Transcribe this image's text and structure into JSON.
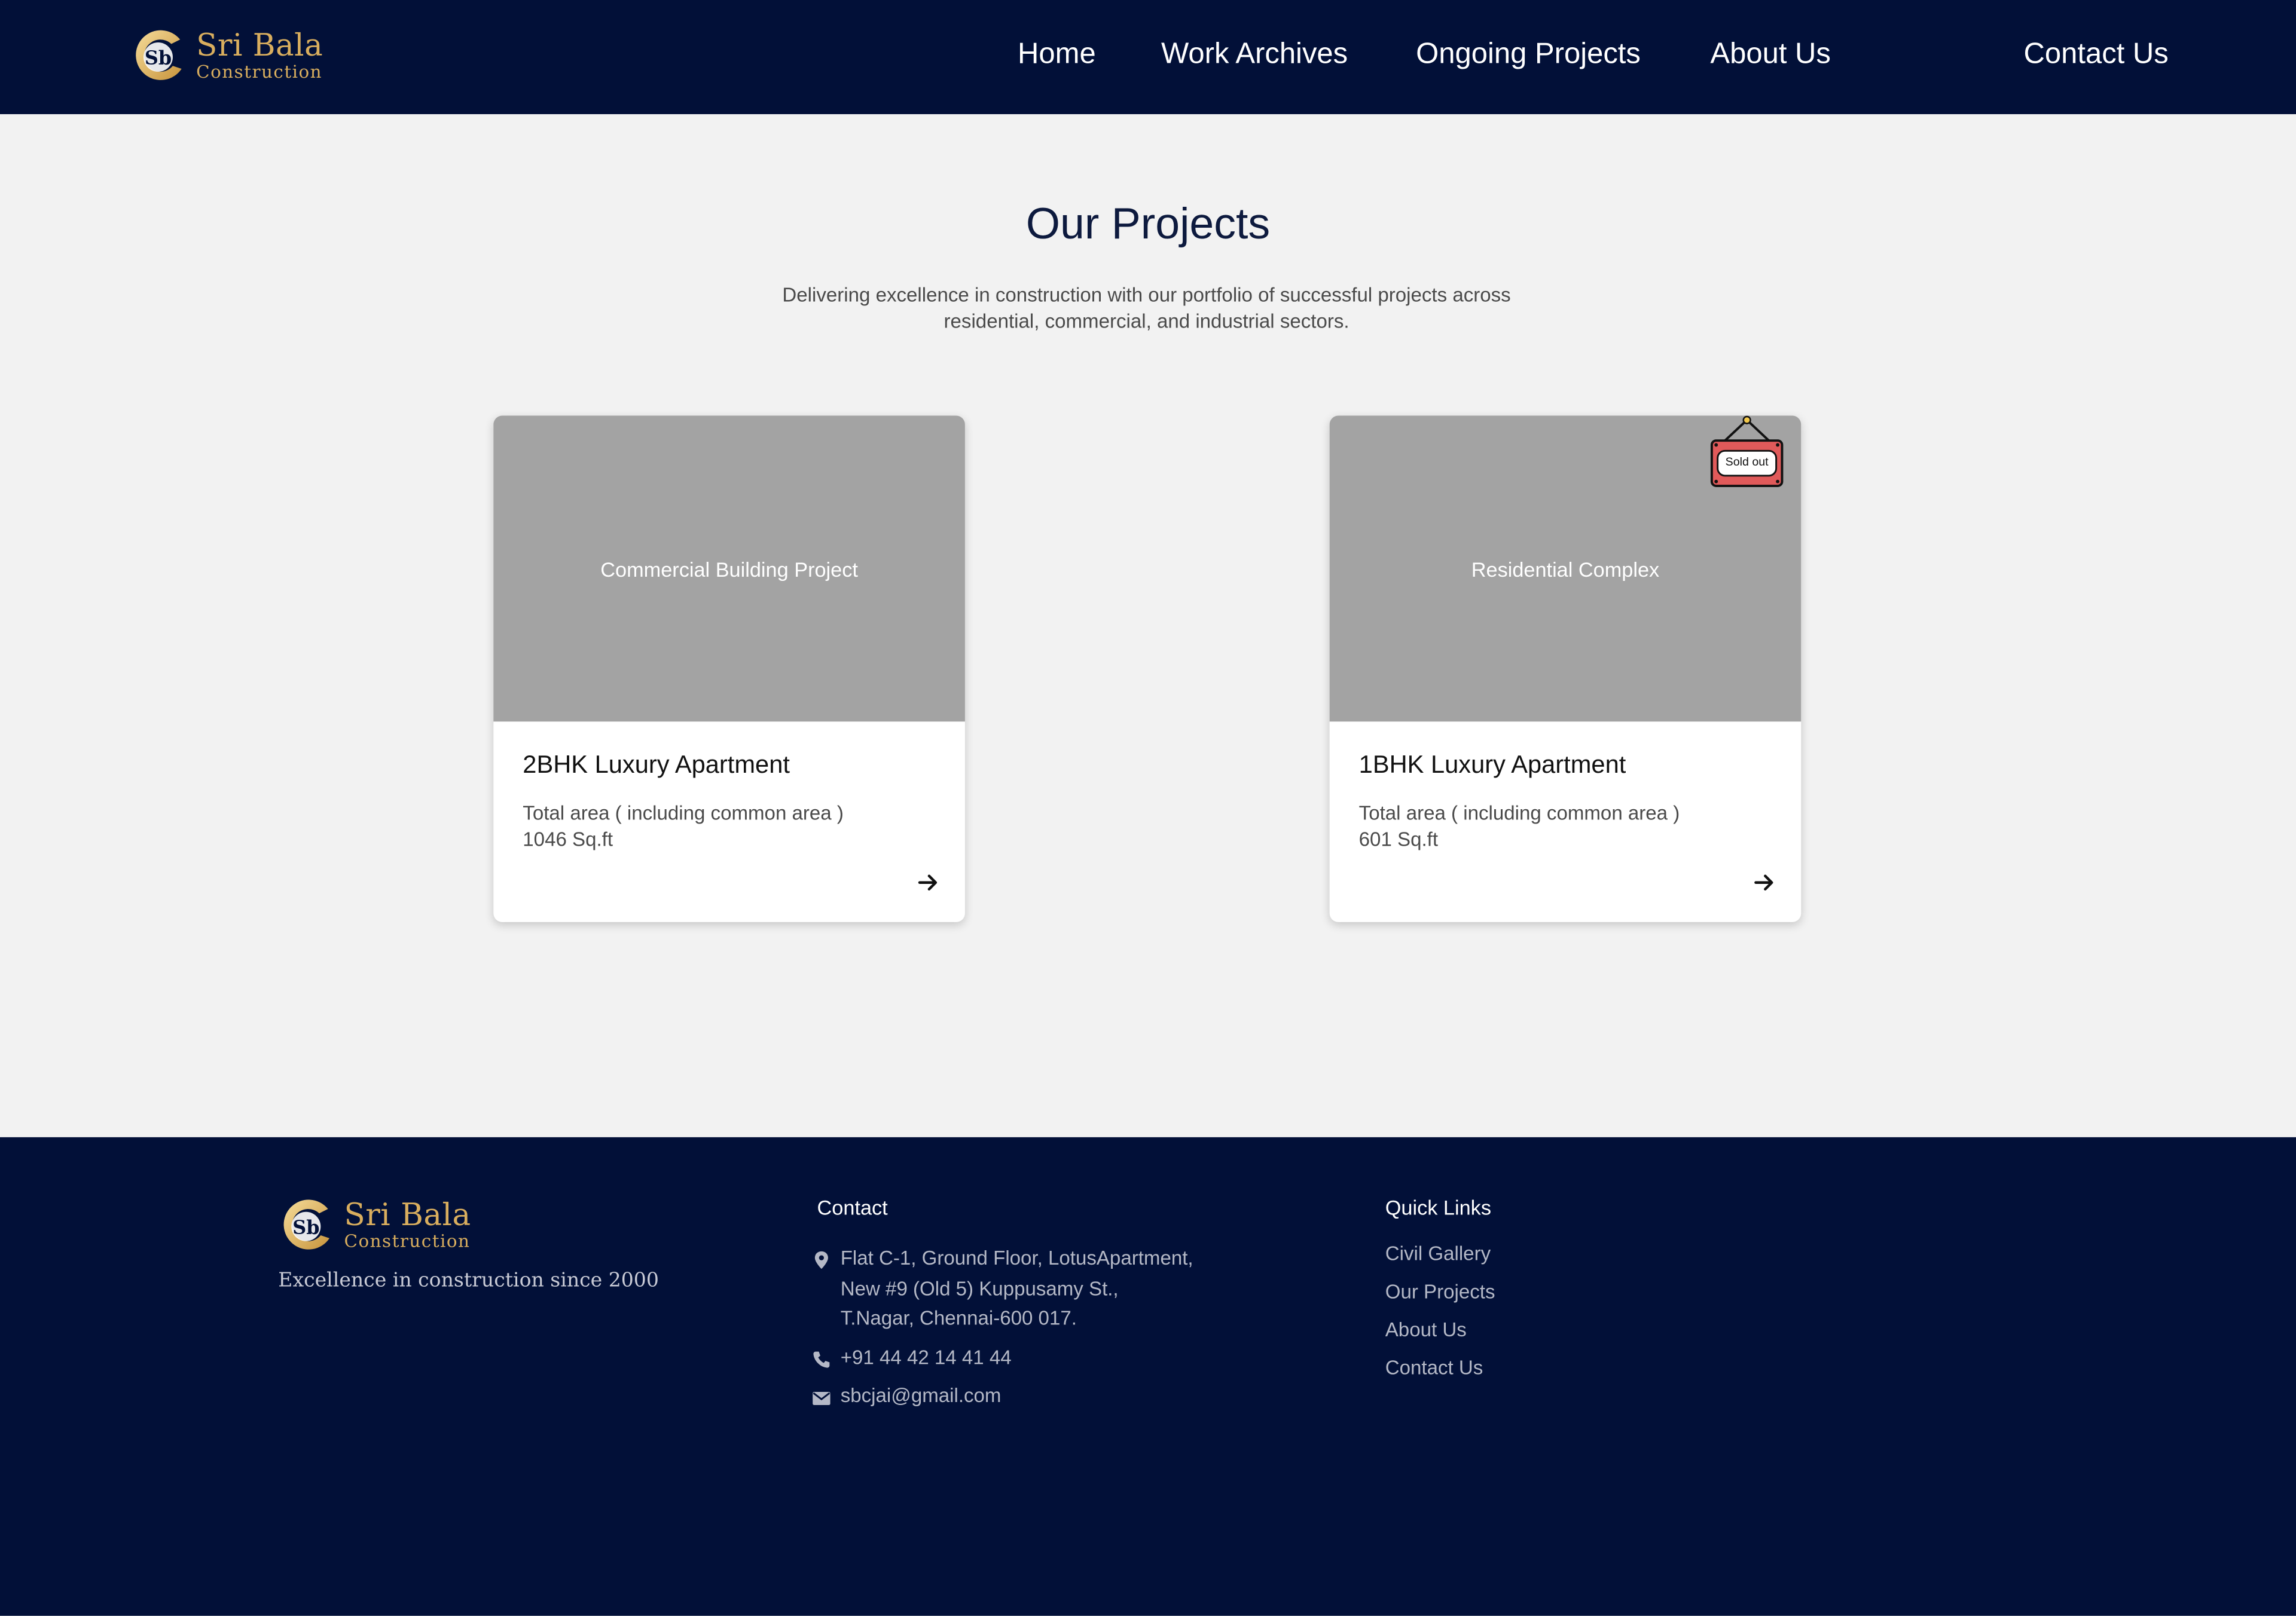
{
  "brand": {
    "title": "Sri Bala",
    "subtitle": "Construction",
    "mark": "Sb",
    "color": "#d9ae5e"
  },
  "nav": {
    "home": "Home",
    "work_archives": "Work Archives",
    "ongoing_projects": "Ongoing Projects",
    "about_us": "About Us",
    "contact_us": "Contact Us"
  },
  "main": {
    "title": "Our Projects",
    "subtitle_line1": "Delivering excellence in construction with our portfolio of successful projects across",
    "subtitle_line2": "residential, commercial, and industrial sectors."
  },
  "projects": [
    {
      "image_label": "Commercial Building Project",
      "title": "2BHK Luxury Apartment",
      "area_label": "Total area ( including common area )",
      "area_value": "1046 Sq.ft",
      "sold_out": false
    },
    {
      "image_label": "Residential Complex",
      "title": "1BHK Luxury Apartment",
      "area_label": "Total area ( including common area )",
      "area_value": "601 Sq.ft",
      "sold_out": true,
      "sold_label": "Sold out"
    }
  ],
  "footer": {
    "tagline": "Excellence in construction since 2000",
    "contact_heading": "Contact",
    "address_lines": [
      "Flat C-1, Ground Floor, LotusApartment,",
      "New #9 (Old 5) Kuppusamy St.,",
      "T.Nagar, Chennai-600 017."
    ],
    "phone": "+91 44 42 14 41 44",
    "email": "sbcjai@gmail.com",
    "quick_links_heading": "Quick Links",
    "quick_links": [
      "Civil Gallery",
      "Our Projects",
      "About Us",
      "Contact Us"
    ]
  },
  "colors": {
    "navy": "#021038",
    "gold": "#d9ae5e",
    "page_bg": "#f2f2f2",
    "card_image": "#a3a3a3",
    "sold_sign": "#e05a5a"
  },
  "icons": [
    "location-pin-icon",
    "phone-icon",
    "mail-icon",
    "arrow-right-icon",
    "sold-out-sign-icon"
  ]
}
